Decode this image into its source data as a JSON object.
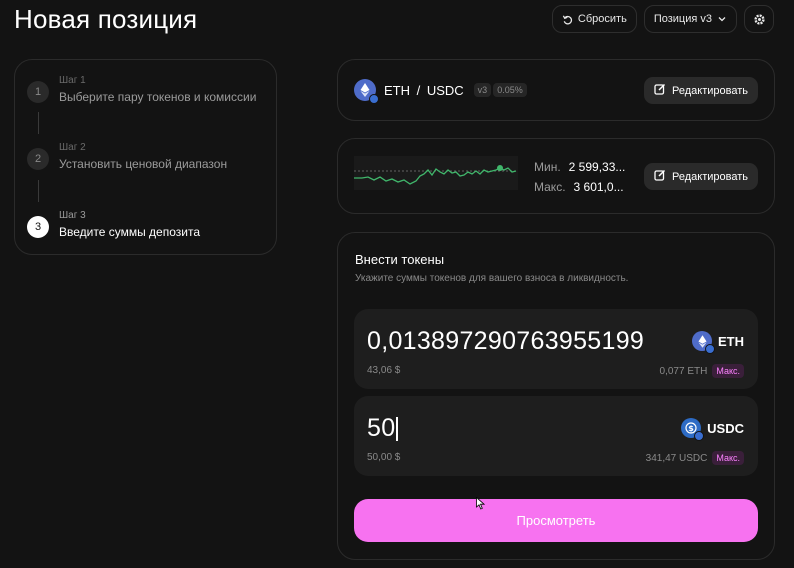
{
  "page": {
    "title": "Новая позиция"
  },
  "header": {
    "reset_label": "Сбросить",
    "version_label": "Позиция v3"
  },
  "steps": [
    {
      "number": "1",
      "small": "Шаг 1",
      "main": "Выберите пару токенов и комиссии"
    },
    {
      "number": "2",
      "small": "Шаг 2",
      "main": "Установить ценовой диапазон"
    },
    {
      "number": "3",
      "small": "Шаг 3",
      "main": "Введите суммы депозита"
    }
  ],
  "pair": {
    "name": "ETH / USDC",
    "version": "v3",
    "fee": "0.05%",
    "edit_label": "Редактировать"
  },
  "range": {
    "min_label": "Мин.",
    "min_value": "2 599,33...",
    "max_label": "Макс.",
    "max_value": "3 601,0...",
    "edit_label": "Редактировать",
    "chart_color": "#40b66b"
  },
  "deposit": {
    "title": "Внести токены",
    "subtitle": "Укажите суммы токенов для вашего взноса в ликвидность.",
    "eth": {
      "amount": "0,013897290763955199",
      "usd": "43,06 $",
      "symbol": "ETH",
      "balance": "0,077 ETH",
      "max_label": "Макс."
    },
    "usdc": {
      "amount": "50",
      "usd": "50,00 $",
      "symbol": "USDC",
      "balance": "341,47 USDC",
      "max_label": "Макс."
    },
    "review_label": "Просмотреть"
  },
  "colors": {
    "accent": "#f772f0",
    "background": "#131313",
    "eth_icon": "#4f6cc9",
    "usdc_icon": "#2d6bc5"
  },
  "icons": {
    "reset": "undo-icon",
    "version": "chevron-down-icon",
    "settings": "gear-icon",
    "edit": "edit-icon"
  }
}
